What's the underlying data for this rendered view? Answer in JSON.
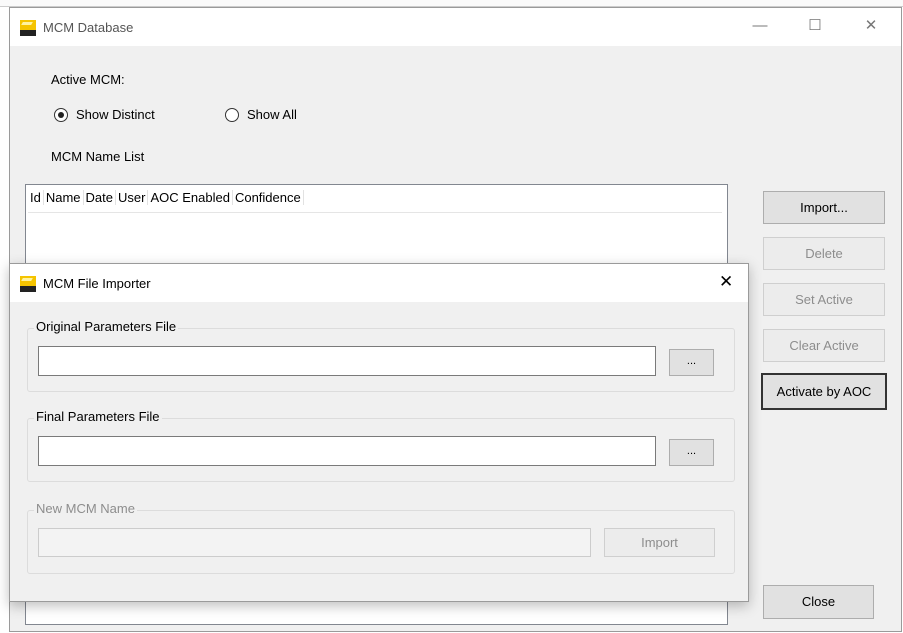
{
  "main_window": {
    "title": "MCM Database",
    "controls": {
      "minimize": "—",
      "maximize": "☐",
      "close": "✕"
    },
    "active_mcm_label": "Active MCM:",
    "radio_show_distinct": "Show Distinct",
    "radio_show_all": "Show All",
    "radio_selected": "show_distinct",
    "name_list_label": "MCM Name List",
    "columns": [
      "Id",
      "Name",
      "Date",
      "User",
      "AOC Enabled",
      "Confidence"
    ],
    "buttons": {
      "import": "Import...",
      "delete": "Delete",
      "set_active": "Set Active",
      "clear_active": "Clear Active",
      "activate_by_aoc": "Activate by AOC",
      "close": "Close"
    }
  },
  "importer_dialog": {
    "title": "MCM File Importer",
    "close": "✕",
    "original_group_label": "Original Parameters File",
    "original_value": "",
    "original_browse": "...",
    "final_group_label": "Final Parameters File",
    "final_value": "",
    "final_browse": "...",
    "name_group_label": "New MCM Name",
    "name_value": "",
    "import_button": "Import"
  },
  "colors": {
    "logo_yellow": "#f5c400",
    "window_bg": "#f0f0f0"
  }
}
